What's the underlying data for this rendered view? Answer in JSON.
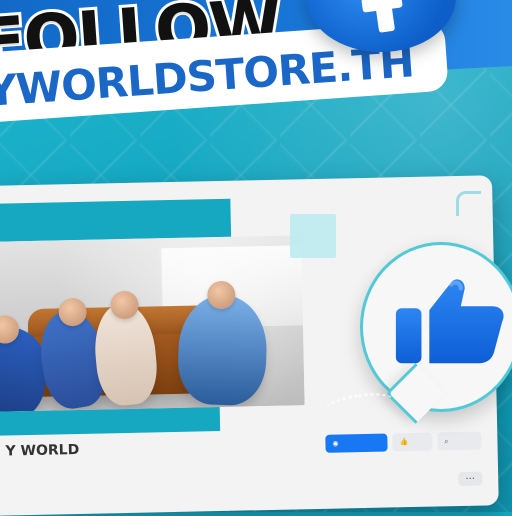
{
  "banner": {
    "follow_text": "FOLLOW",
    "handle_text": "YWORLDSTORE.TH"
  },
  "page": {
    "name": "Y WORLD",
    "meta": "",
    "tabs": [
      "",
      "",
      "",
      ""
    ]
  },
  "buttons": {
    "follow_label": "",
    "like_label": "",
    "search_label": "",
    "more_label": "···"
  },
  "icons": {
    "facebook": "facebook-icon",
    "thumbs_up": "thumbs-up-icon"
  },
  "colors": {
    "teal": "#16a8c0",
    "facebook_blue": "#1877f2"
  }
}
